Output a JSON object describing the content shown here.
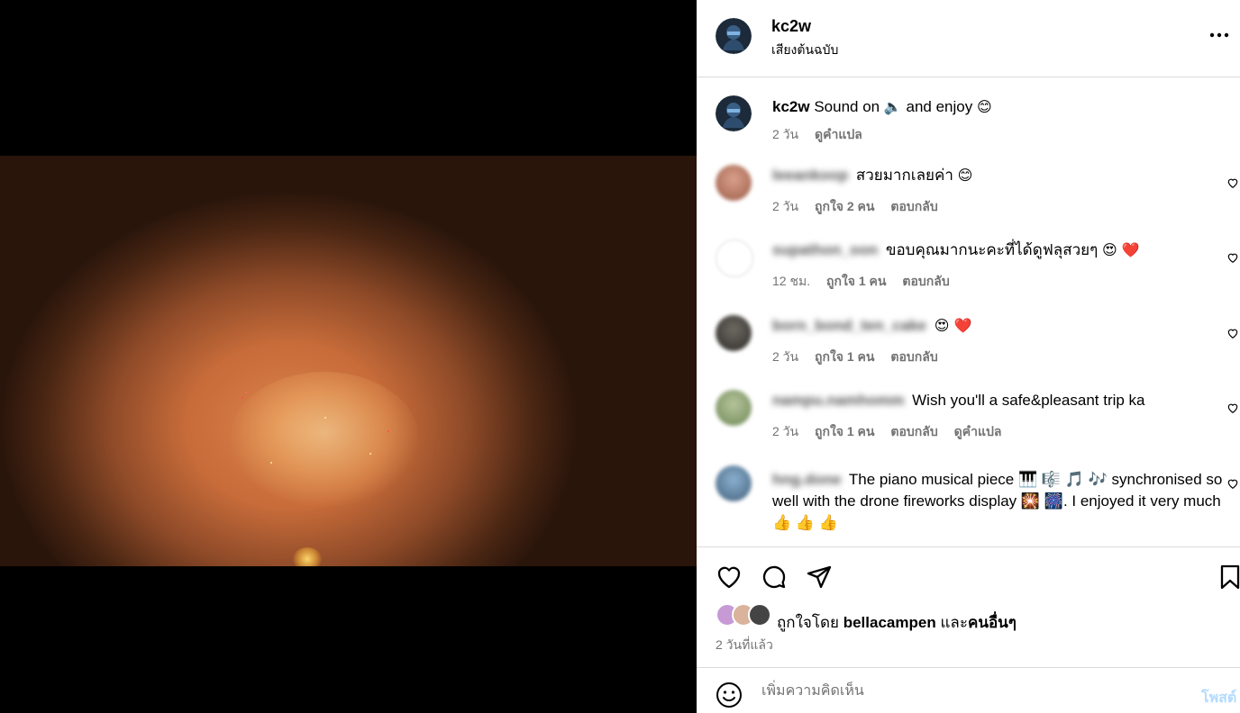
{
  "post": {
    "username": "kc2w",
    "audio": "เสียงต้นฉบับ",
    "caption": "Sound on",
    "caption_emoji_1": "🔈",
    "caption_rest": "and enjoy",
    "caption_emoji_2": "😊",
    "caption_time": "2 วัน",
    "translate": "ดูคำแปล"
  },
  "comments": [
    {
      "user": "leeankoop",
      "text": "สวยมากเลยค่า",
      "emoji": "😊",
      "time": "2 วัน",
      "likes": "ถูกใจ 2 คน",
      "reply": "ตอบกลับ",
      "translate": ""
    },
    {
      "user": "supathon_oon",
      "text": "ขอบคุณมากนะคะที่ได้ดูฟลุสวยๆ",
      "emoji": "😍 ❤️",
      "time": "12 ชม.",
      "likes": "ถูกใจ 1 คน",
      "reply": "ตอบกลับ",
      "translate": ""
    },
    {
      "user": "born_bond_ten_cake",
      "text": "",
      "emoji": "😍 ❤️",
      "time": "2 วัน",
      "likes": "ถูกใจ 1 คน",
      "reply": "ตอบกลับ",
      "translate": ""
    },
    {
      "user": "nampu.namhomm",
      "text": "Wish you'll a safe&pleasant trip ka",
      "emoji": "",
      "time": "2 วัน",
      "likes": "ถูกใจ 1 คน",
      "reply": "ตอบกลับ",
      "translate": "ดูคำแปล"
    },
    {
      "user": "hng.done",
      "text": "The piano musical piece 🎹 🎼 🎵 🎶 synchronised so well with the drone fireworks display 🎇 🎆. I enjoyed it very much 👍 👍 👍",
      "emoji": "",
      "time": "",
      "likes": "",
      "reply": "",
      "translate": ""
    }
  ],
  "likes": {
    "prefix": "ถูกใจโดย",
    "user": "bellacampen",
    "mid": "และ",
    "others": "คนอื่นๆ"
  },
  "posted_ago": "2 วันที่แล้ว",
  "add_comment": {
    "placeholder": "เพิ่มความคิดเห็น",
    "post_label": "โพสต์"
  },
  "colors": {
    "meta_gray": "#737373",
    "border": "#dbdbdb",
    "post_button": "#b3dbff",
    "heart_red": "#ed4956"
  },
  "icons": {
    "more": "more-horizontal-icon",
    "like": "heart-icon",
    "comment": "comment-bubble-icon",
    "share": "paper-plane-icon",
    "save": "bookmark-icon",
    "emoji": "smiley-icon",
    "mute": "speaker-icon"
  }
}
